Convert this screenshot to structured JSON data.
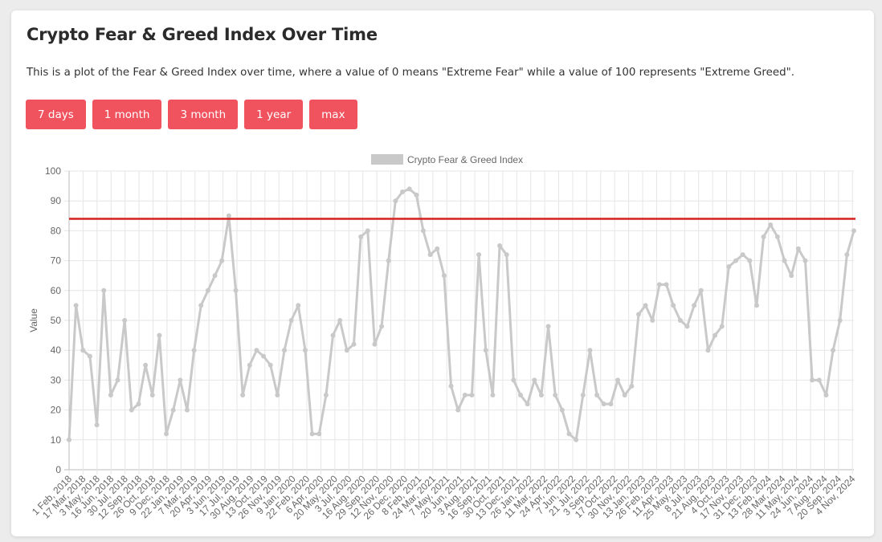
{
  "header": {
    "title": "Crypto Fear & Greed Index Over Time",
    "description": "This is a plot of the Fear & Greed Index over time, where a value of 0 means \"Extreme Fear\" while a value of 100 represents \"Extreme Greed\"."
  },
  "range_buttons": [
    "7 days",
    "1 month",
    "3 month",
    "1 year",
    "max"
  ],
  "colors": {
    "button": "#f0525e",
    "series": "#c9c9c9",
    "reference_line": "#d62020"
  },
  "chart_data": {
    "type": "line",
    "legend": "Crypto Fear & Greed Index",
    "legend_position": "top",
    "ylabel": "Value",
    "ylim": [
      0,
      100
    ],
    "yticks": [
      0,
      10,
      20,
      30,
      40,
      50,
      60,
      70,
      80,
      90,
      100
    ],
    "grid": true,
    "reference_line": 84,
    "x_tick_labels": [
      "1 Feb, 2018",
      "17 Mar, 2018",
      "3 May, 2018",
      "16 Jun, 2018",
      "30 Jul, 2018",
      "12 Sep, 2018",
      "26 Oct, 2018",
      "9 Dec, 2018",
      "22 Jan, 2019",
      "7 Mar, 2019",
      "20 Apr, 2019",
      "3 Jun, 2019",
      "17 Jul, 2019",
      "30 Aug, 2019",
      "13 Oct, 2019",
      "26 Nov, 2019",
      "9 Jan, 2020",
      "22 Feb, 2020",
      "6 Apr, 2020",
      "20 May, 2020",
      "3 Jul, 2020",
      "16 Aug, 2020",
      "29 Sep, 2020",
      "12 Nov, 2020",
      "26 Dec, 2020",
      "8 Feb, 2021",
      "24 Mar, 2021",
      "7 May, 2021",
      "20 Jun, 2021",
      "3 Aug, 2021",
      "16 Sep, 2021",
      "30 Oct, 2021",
      "13 Dec, 2021",
      "26 Jan, 2022",
      "11 Mar, 2022",
      "24 Apr, 2022",
      "7 Jun, 2022",
      "21 Jul, 2022",
      "3 Sep, 2022",
      "17 Oct, 2022",
      "30 Nov, 2022",
      "13 Jan, 2023",
      "26 Feb, 2023",
      "11 Apr, 2023",
      "25 May, 2023",
      "8 Jul, 2023",
      "21 Aug, 2023",
      "4 Oct, 2023",
      "17 Nov, 2023",
      "31 Dec, 2023",
      "13 Feb, 2024",
      "28 Mar, 2024",
      "11 May, 2024",
      "24 Jun, 2024",
      "7 Aug, 2024",
      "20 Sep, 2024",
      "4 Nov, 2024"
    ],
    "values": [
      10,
      55,
      40,
      38,
      15,
      60,
      25,
      30,
      50,
      20,
      22,
      35,
      25,
      45,
      12,
      20,
      30,
      20,
      40,
      55,
      60,
      65,
      70,
      85,
      60,
      25,
      35,
      40,
      38,
      35,
      25,
      40,
      50,
      55,
      40,
      12,
      12,
      25,
      45,
      50,
      40,
      42,
      78,
      80,
      42,
      48,
      70,
      90,
      93,
      94,
      92,
      80,
      72,
      74,
      65,
      28,
      20,
      25,
      25,
      72,
      40,
      25,
      75,
      72,
      30,
      25,
      22,
      30,
      25,
      48,
      25,
      20,
      12,
      10,
      25,
      40,
      25,
      22,
      22,
      30,
      25,
      28,
      52,
      55,
      50,
      62,
      62,
      55,
      50,
      48,
      55,
      60,
      40,
      45,
      48,
      68,
      70,
      72,
      70,
      55,
      78,
      82,
      78,
      70,
      65,
      74,
      70,
      30,
      30,
      25,
      40,
      50,
      72,
      80
    ]
  }
}
